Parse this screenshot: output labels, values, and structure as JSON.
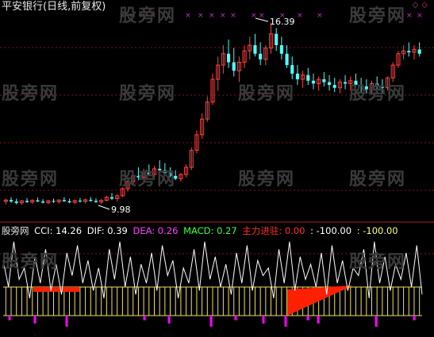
{
  "title": "平安银行(日线,前复权)",
  "watermark": "股旁网",
  "corner_markers": "◇◇",
  "colors": {
    "background": "#000000",
    "up": "#ff4040",
    "down": "#54fcfc",
    "white_line": "#ffffff",
    "yellow": "#f0e060",
    "magenta": "#ff00ff",
    "red_fill": "#ff2000",
    "grid": "#7a1818",
    "marker": "#c030c0"
  },
  "price_panel": {
    "high_label": "16.39",
    "low_label": "9.98"
  },
  "indicator": {
    "name": "股旁网",
    "cci_label": "CCI: 14.26",
    "dif_label": "DIF: 0.39",
    "dea_label": "DEA: 0.26",
    "macd_label": "MACD: 0.27",
    "zhuli_label": "主力进驻: 0.00",
    "level1_label": ": -100.00",
    "level2_label": ": -100.00"
  },
  "chart_data": {
    "type": "candlestick",
    "price_range": [
      9.98,
      16.39
    ],
    "candles": [
      [
        10.1,
        10.2,
        10.0,
        10.15
      ],
      [
        10.15,
        10.25,
        10.05,
        10.1
      ],
      [
        10.1,
        10.2,
        10.0,
        10.05
      ],
      [
        10.05,
        10.15,
        9.98,
        10.12
      ],
      [
        10.12,
        10.22,
        10.05,
        10.08
      ],
      [
        10.08,
        10.18,
        10.02,
        10.14
      ],
      [
        10.14,
        10.24,
        10.08,
        10.1
      ],
      [
        10.1,
        10.18,
        10.03,
        10.06
      ],
      [
        10.06,
        10.16,
        10.0,
        10.12
      ],
      [
        10.12,
        10.2,
        10.05,
        10.09
      ],
      [
        10.09,
        10.18,
        10.02,
        10.15
      ],
      [
        10.15,
        10.25,
        10.08,
        10.11
      ],
      [
        10.11,
        10.2,
        10.04,
        10.07
      ],
      [
        10.07,
        10.17,
        10.01,
        10.13
      ],
      [
        10.13,
        10.22,
        10.06,
        10.1
      ],
      [
        10.1,
        10.2,
        10.03,
        10.16
      ],
      [
        10.16,
        10.26,
        10.09,
        10.12
      ],
      [
        10.12,
        10.21,
        10.05,
        10.08
      ],
      [
        10.08,
        10.18,
        10.02,
        10.14
      ],
      [
        10.14,
        10.3,
        10.1,
        10.25
      ],
      [
        10.25,
        10.4,
        10.15,
        10.2
      ],
      [
        10.2,
        10.35,
        10.1,
        10.3
      ],
      [
        10.3,
        10.6,
        10.25,
        10.55
      ],
      [
        10.55,
        10.9,
        10.45,
        10.8
      ],
      [
        10.8,
        11.1,
        10.7,
        11.0
      ],
      [
        11.0,
        11.3,
        10.85,
        10.95
      ],
      [
        10.95,
        11.25,
        10.8,
        11.15
      ],
      [
        11.15,
        11.4,
        11.0,
        11.05
      ],
      [
        11.05,
        11.35,
        10.95,
        11.25
      ],
      [
        11.25,
        11.55,
        11.1,
        11.2
      ],
      [
        11.2,
        11.45,
        11.05,
        11.1
      ],
      [
        11.1,
        11.3,
        10.95,
        11.0
      ],
      [
        11.0,
        11.2,
        10.85,
        10.9
      ],
      [
        10.9,
        11.1,
        10.8,
        11.05
      ],
      [
        11.05,
        11.4,
        10.95,
        11.3
      ],
      [
        11.3,
        12.0,
        11.2,
        11.9
      ],
      [
        11.9,
        12.6,
        11.8,
        12.45
      ],
      [
        12.45,
        13.2,
        12.3,
        13.0
      ],
      [
        13.0,
        13.8,
        12.9,
        13.6
      ],
      [
        13.6,
        14.6,
        13.5,
        14.4
      ],
      [
        14.4,
        15.2,
        14.0,
        14.9
      ],
      [
        14.9,
        15.6,
        14.6,
        15.3
      ],
      [
        15.3,
        15.8,
        14.8,
        15.0
      ],
      [
        15.0,
        15.5,
        14.5,
        14.7
      ],
      [
        14.7,
        15.2,
        14.3,
        15.0
      ],
      [
        15.0,
        15.6,
        14.8,
        15.4
      ],
      [
        15.4,
        15.9,
        15.1,
        15.6
      ],
      [
        15.6,
        16.0,
        15.2,
        15.3
      ],
      [
        15.3,
        15.7,
        14.9,
        15.1
      ],
      [
        15.1,
        15.6,
        14.9,
        15.5
      ],
      [
        15.5,
        16.39,
        15.3,
        16.0
      ],
      [
        16.0,
        16.2,
        15.4,
        15.6
      ],
      [
        15.6,
        15.9,
        15.1,
        15.3
      ],
      [
        15.3,
        15.6,
        14.8,
        14.9
      ],
      [
        14.9,
        15.2,
        14.4,
        14.6
      ],
      [
        14.6,
        14.9,
        14.2,
        14.4
      ],
      [
        14.4,
        14.7,
        14.1,
        14.55
      ],
      [
        14.55,
        14.8,
        14.2,
        14.35
      ],
      [
        14.35,
        14.6,
        14.05,
        14.25
      ],
      [
        14.25,
        14.5,
        14.0,
        14.4
      ],
      [
        14.4,
        14.65,
        14.15,
        14.3
      ],
      [
        14.3,
        14.55,
        14.0,
        14.2
      ],
      [
        14.2,
        14.45,
        13.95,
        14.1
      ],
      [
        14.1,
        14.4,
        13.9,
        14.3
      ],
      [
        14.3,
        14.55,
        14.05,
        14.25
      ],
      [
        14.25,
        14.5,
        14.0,
        14.35
      ],
      [
        14.35,
        14.6,
        14.1,
        14.2
      ],
      [
        14.2,
        14.45,
        13.95,
        14.15
      ],
      [
        14.15,
        14.4,
        13.9,
        14.05
      ],
      [
        14.05,
        14.35,
        13.85,
        14.25
      ],
      [
        14.25,
        14.5,
        14.0,
        14.15
      ],
      [
        14.15,
        14.4,
        13.9,
        14.1
      ],
      [
        14.1,
        14.5,
        14.0,
        14.45
      ],
      [
        14.45,
        15.0,
        14.3,
        14.9
      ],
      [
        14.9,
        15.4,
        14.8,
        15.3
      ],
      [
        15.3,
        15.6,
        15.1,
        15.4
      ],
      [
        15.4,
        15.7,
        15.2,
        15.35
      ],
      [
        15.35,
        15.6,
        15.1,
        15.45
      ],
      [
        15.45,
        15.7,
        15.2,
        15.3
      ]
    ],
    "cci_line": [
      70,
      35,
      95,
      45,
      60,
      20,
      75,
      40,
      85,
      30,
      65,
      25,
      80,
      50,
      90,
      40,
      70,
      30,
      60,
      20,
      85,
      45,
      95,
      35,
      75,
      25,
      65,
      40,
      80,
      30,
      90,
      50,
      70,
      20,
      60,
      40,
      85,
      30,
      95,
      45,
      75,
      35,
      65,
      25,
      80,
      40,
      90,
      30,
      70,
      50,
      60,
      20,
      85,
      40,
      95,
      30,
      75,
      45,
      65,
      35,
      80,
      25,
      90,
      40,
      70,
      30,
      60,
      50,
      85,
      20,
      95,
      40,
      75,
      30,
      65,
      45,
      80,
      35,
      90,
      25
    ],
    "macd_bars": [
      0,
      0,
      0,
      0,
      0,
      0,
      0,
      0,
      0,
      0,
      0,
      0,
      0,
      0,
      0,
      0,
      0,
      0,
      0,
      0,
      0,
      0,
      0,
      0,
      0,
      0,
      0,
      0,
      0,
      0,
      0,
      0,
      0,
      0,
      0,
      0,
      0,
      0,
      0,
      0,
      0,
      0,
      0,
      0,
      0,
      0,
      0,
      0,
      0,
      0,
      0,
      0,
      0,
      0,
      0,
      0,
      0,
      0,
      0,
      0,
      0,
      0,
      0,
      0,
      0,
      0,
      0,
      0,
      0,
      0,
      0,
      0,
      0,
      0,
      0,
      0,
      0,
      0,
      0,
      0
    ]
  }
}
